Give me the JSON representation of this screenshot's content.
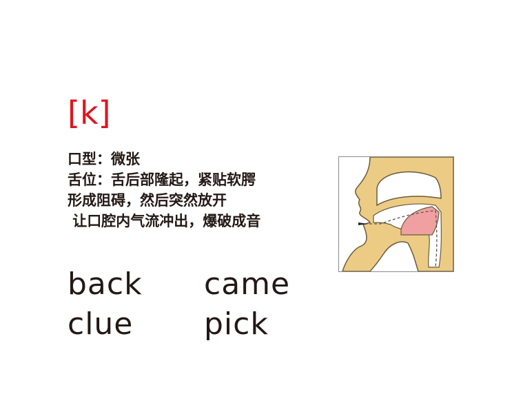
{
  "phoneme": "[k]",
  "description": {
    "lines": [
      "口型：微张",
      "舌位：舌后部隆起，紧贴软腭",
      "形成阻碍，然后突然放开",
      " 让口腔内气流冲出，爆破成音"
    ]
  },
  "words": [
    "back",
    "came",
    "clue",
    "pick"
  ],
  "figure": {
    "icon": "mouth-cross-section-diagram"
  },
  "colors": {
    "phoneme": "#e0141e",
    "text": "#231815",
    "skin": "#eccb85",
    "tongue": "#f0a0a0"
  }
}
